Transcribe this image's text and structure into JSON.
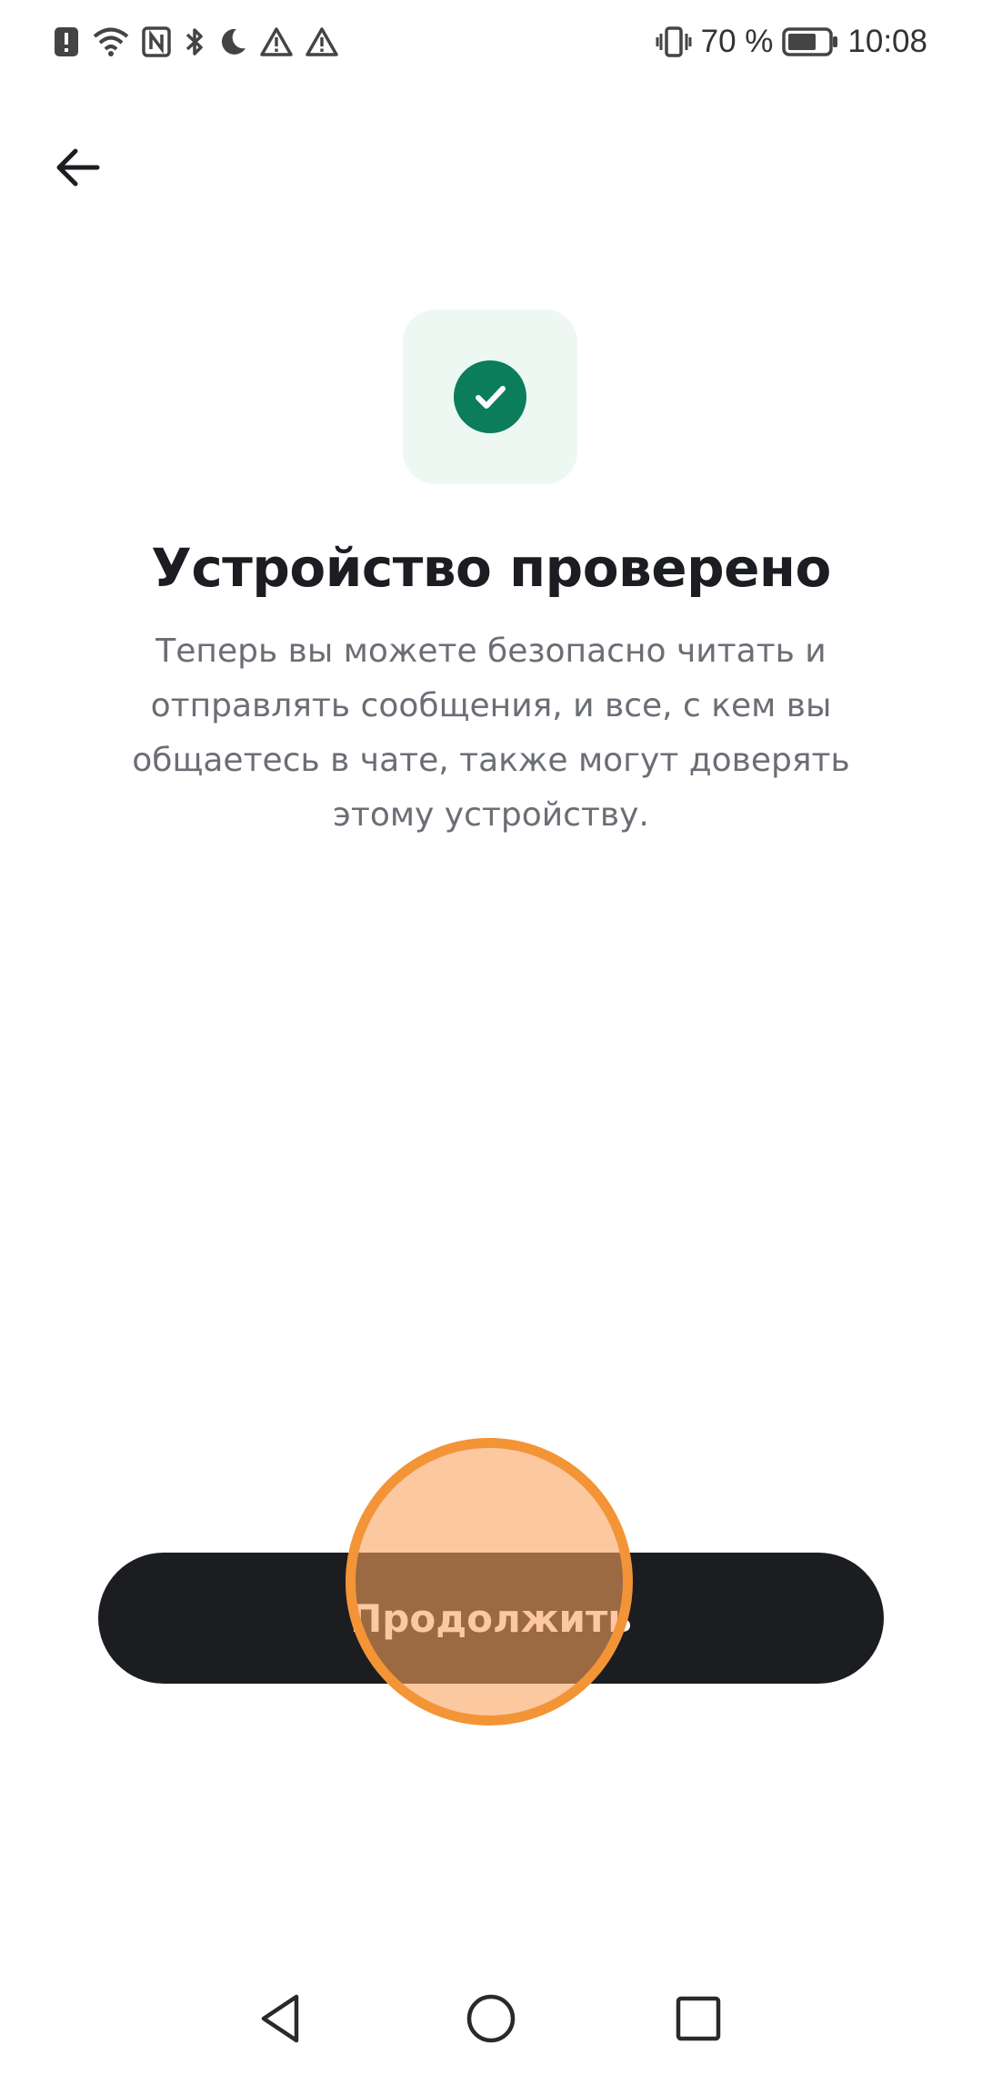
{
  "status_bar": {
    "battery_percent": "70 %",
    "time": "10:08",
    "icons": [
      "alert-icon",
      "wifi-icon",
      "nfc-icon",
      "bluetooth-icon",
      "do-not-disturb-icon",
      "warning-icon",
      "warning-icon",
      "vibrate-icon",
      "battery-icon"
    ],
    "battery_level": 0.7
  },
  "header": {
    "back_icon": "arrow-left-icon"
  },
  "badge": {
    "icon": "check-circle-icon",
    "color": "#0b7d5b",
    "tile_color": "#edf8f2"
  },
  "main": {
    "title": "Устройство проверено",
    "description": "Теперь вы можете безопасно читать и отправлять сообщения, и все, с кем вы общаетесь в чате, также могут доверять этому устройству."
  },
  "actions": {
    "continue_label": "Продолжить"
  },
  "nav_bar": {
    "icons": [
      "back-triangle-icon",
      "home-circle-icon",
      "recents-square-icon"
    ]
  }
}
